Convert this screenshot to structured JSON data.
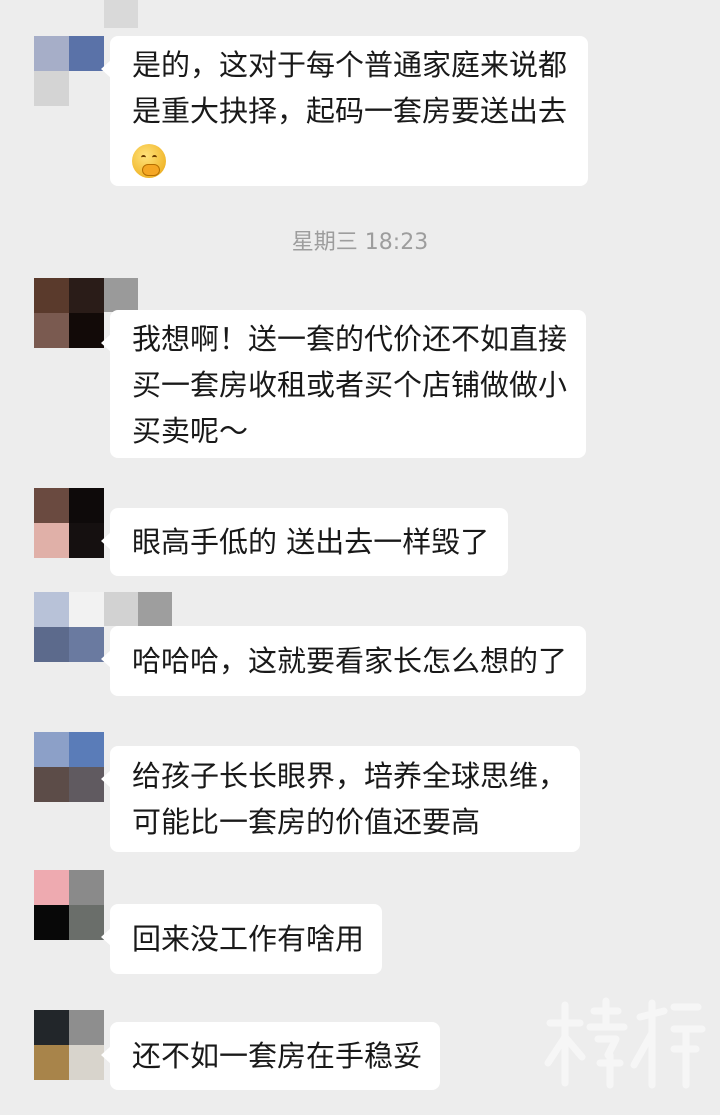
{
  "chat": {
    "timestamp": "星期三 18:23",
    "messages": [
      {
        "lines": [
          "是的，这对于每个普通家庭来说都",
          "是重大抉择，起码一套房要送出去"
        ],
        "emoji": "thinking-emoji"
      },
      {
        "lines": [
          "我想啊！送一套的代价还不如直接",
          "买一套房收租或者买个店铺做做小",
          "买卖呢～"
        ]
      },
      {
        "lines": [
          "眼高手低的 送出去一样毁了"
        ]
      },
      {
        "lines": [
          "哈哈哈，这就要看家长怎么想的了"
        ]
      },
      {
        "lines": [
          "给孩子长长眼界，培养全球思维，",
          "可能比一套房的价值还要高"
        ]
      },
      {
        "lines": [
          "回来没工作有啥用"
        ]
      },
      {
        "lines": [
          "还不如一套房在手稳妥"
        ]
      }
    ]
  },
  "watermark": {
    "icon": "brand-watermark-logo"
  }
}
